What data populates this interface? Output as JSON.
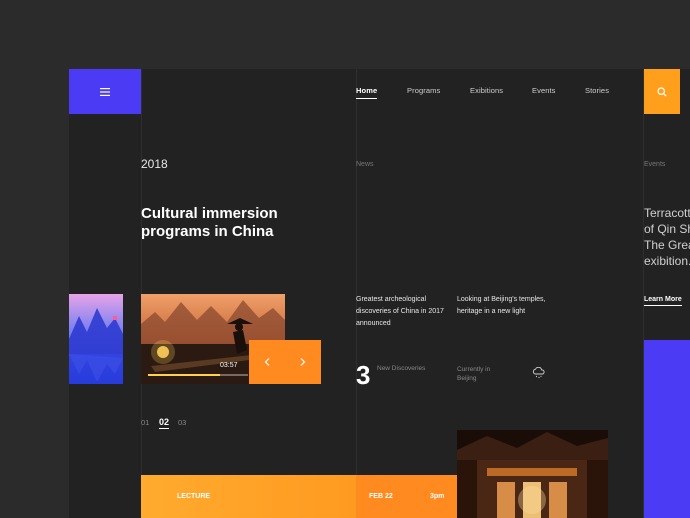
{
  "nav": {
    "items": [
      {
        "label": "Home",
        "active": true
      },
      {
        "label": "Programs",
        "active": false
      },
      {
        "label": "Exibitions",
        "active": false
      },
      {
        "label": "Events",
        "active": false
      },
      {
        "label": "Stories",
        "active": false
      }
    ]
  },
  "hero": {
    "year": "2018",
    "headline": "Cultural immersion programs in China",
    "video_time": "03:57",
    "video_progress_fraction": 0.72
  },
  "pagination": [
    "01",
    "02",
    "03"
  ],
  "news": {
    "label": "News",
    "items": [
      "Greatest archeological discoveries of China in 2017 announced",
      "Looking at Beijing's temples, heritage in a new light"
    ],
    "discoveries_count": "3",
    "discoveries_label": "New Discoveries",
    "location_label": "Currently in Beijing"
  },
  "events": {
    "label": "Events",
    "text_lines": [
      "Terracott",
      "of Qin Sh",
      "The Grea",
      "exibition."
    ],
    "learn_more": "Learn More"
  },
  "lecture": {
    "type": "LECTURE",
    "date": "FEB 22",
    "time": "3pm"
  },
  "colors": {
    "accent_purple": "#4b3bf5",
    "accent_orange": "#ff9f1c",
    "background": "#222222"
  },
  "icons": {
    "menu": "hamburger-menu-icon",
    "search": "search-icon",
    "prev": "chevron-left-icon",
    "next": "chevron-right-icon",
    "weather": "cloud-snow-icon"
  }
}
